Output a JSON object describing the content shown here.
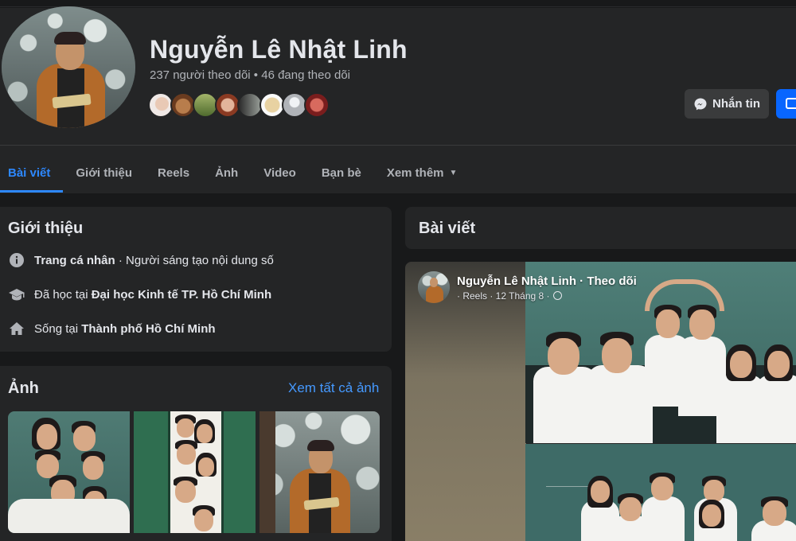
{
  "profile": {
    "name": "Nguyễn Lê Nhật Linh",
    "stats": "237 người theo dõi • 46 đang theo dõi",
    "message_button": "Nhắn tin"
  },
  "tabs": [
    {
      "label": "Bài viết",
      "active": true
    },
    {
      "label": "Giới thiệu"
    },
    {
      "label": "Reels"
    },
    {
      "label": "Ảnh"
    },
    {
      "label": "Video"
    },
    {
      "label": "Bạn bè"
    },
    {
      "label": "Xem thêm"
    }
  ],
  "intro": {
    "title": "Giới thiệu",
    "rows": [
      {
        "icon": "info-icon",
        "bold": "Trang cá nhân",
        "rest": " · Người sáng tạo nội dung số"
      },
      {
        "icon": "graduation-cap-icon",
        "prefix": "Đã học tại ",
        "bold": "Đại học Kinh tế TP. Hồ Chí Minh"
      },
      {
        "icon": "home-icon",
        "prefix": "Sống tại ",
        "bold": "Thành phố Hồ Chí Minh"
      }
    ]
  },
  "photos": {
    "title": "Ảnh",
    "see_all": "Xem tất cả ảnh"
  },
  "posts": {
    "title": "Bài viết",
    "author_line": "Nguyễn Lê Nhật Linh · Theo dõi",
    "meta": "· Reels · 12 Tháng 8 ·"
  },
  "colors": {
    "page_bg": "#18191a",
    "card_bg": "#242526",
    "accent": "#2d88ff",
    "primary_button": "#0866ff",
    "secondary_button": "#3a3b3c"
  }
}
